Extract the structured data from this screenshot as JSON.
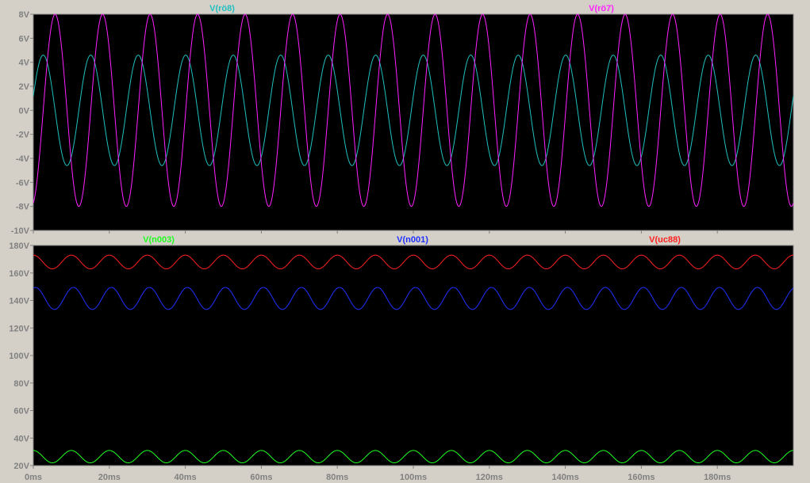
{
  "chart_data": [
    {
      "type": "line",
      "xlabel": "",
      "ylabel": "",
      "xlim": [
        0,
        200
      ],
      "x_ticks": [
        "0ms",
        "20ms",
        "40ms",
        "60ms",
        "80ms",
        "100ms",
        "120ms",
        "140ms",
        "160ms",
        "180ms"
      ],
      "x_tick_values": [
        0,
        20,
        40,
        60,
        80,
        100,
        120,
        140,
        160,
        180
      ],
      "ylim": [
        -10,
        8
      ],
      "y_ticks": [
        "8V",
        "6V",
        "4V",
        "2V",
        "0V",
        "-2V",
        "-4V",
        "-6V",
        "-8V",
        "-10V"
      ],
      "y_tick_values": [
        8,
        6,
        4,
        2,
        0,
        -2,
        -4,
        -6,
        -8,
        -10
      ],
      "grid": false,
      "series": [
        {
          "name": "V(rö8)",
          "color": "#20c0c0",
          "shape": "sine",
          "offset": 0,
          "amplitude": 4.6,
          "period_ms": 12.5,
          "phase_deg": 15
        },
        {
          "name": "V(rö7)",
          "color": "#ff20ff",
          "shape": "sine",
          "offset": 0,
          "amplitude": 8,
          "period_ms": 12.5,
          "phase_deg": -75
        }
      ]
    },
    {
      "type": "line",
      "xlabel": "",
      "ylabel": "",
      "xlim": [
        0,
        200
      ],
      "x_ticks": [
        "0ms",
        "20ms",
        "40ms",
        "60ms",
        "80ms",
        "100ms",
        "120ms",
        "140ms",
        "160ms",
        "180ms"
      ],
      "x_tick_values": [
        0,
        20,
        40,
        60,
        80,
        100,
        120,
        140,
        160,
        180
      ],
      "ylim": [
        20,
        180
      ],
      "y_ticks": [
        "180V",
        "160V",
        "140V",
        "120V",
        "100V",
        "80V",
        "60V",
        "40V",
        "20V"
      ],
      "y_tick_values": [
        180,
        160,
        140,
        120,
        100,
        80,
        60,
        40,
        20
      ],
      "grid": false,
      "series": [
        {
          "name": "V(n003)",
          "color": "#20ff20",
          "shape": "sine",
          "offset": 26.5,
          "amplitude": 4.5,
          "period_ms": 10,
          "phase_deg": 90
        },
        {
          "name": "V(n001)",
          "color": "#2030ff",
          "shape": "sine",
          "offset": 141.5,
          "amplitude": 8,
          "period_ms": 10,
          "phase_deg": 70
        },
        {
          "name": "V(uc88)",
          "color": "#ff2020",
          "shape": "sine",
          "offset": 168,
          "amplitude": 5,
          "period_ms": 10,
          "phase_deg": 90
        }
      ]
    }
  ]
}
